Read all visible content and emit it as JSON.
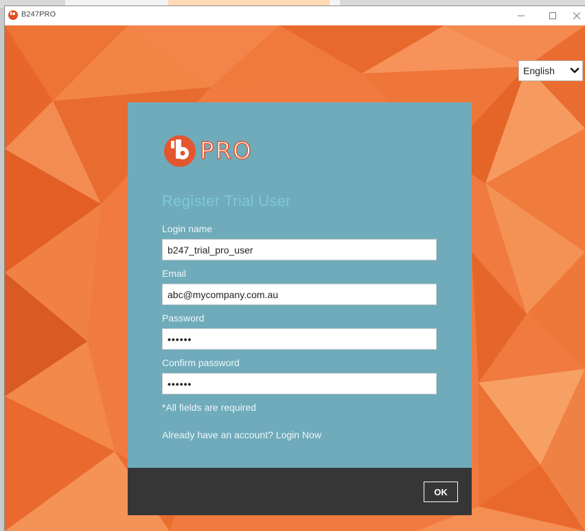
{
  "window": {
    "title": "B247PRO",
    "minimize_icon": "minimize-icon",
    "maximize_icon": "maximize-icon",
    "close_icon": "close-icon"
  },
  "language": {
    "selected": "English",
    "icon": "chevron-down-icon"
  },
  "logo": {
    "word": "PRO",
    "icon": "b247-logo-icon"
  },
  "form": {
    "title": "Register Trial User",
    "login_name_label": "Login name",
    "login_name_value": "b247_trial_pro_user",
    "email_label": "Email",
    "email_value": "abc@mycompany.com.au",
    "password_label": "Password",
    "password_value": "••••••",
    "confirm_label": "Confirm password",
    "confirm_value": "••••••",
    "required_note": "*All fields are required",
    "login_link": "Already have an account? Login Now"
  },
  "footer": {
    "ok_label": "OK"
  },
  "colors": {
    "background_orange": "#f07a3f",
    "panel_teal": "#6fabba",
    "footer_dark": "#363636",
    "logo_orange": "#e4572e"
  }
}
